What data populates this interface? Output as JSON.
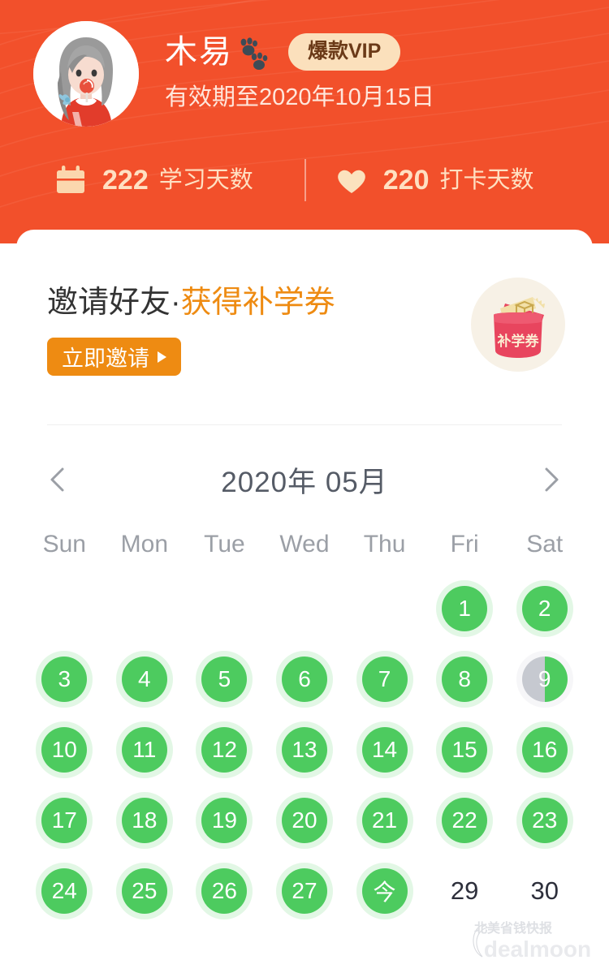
{
  "header": {
    "user_name": "木易",
    "paw_icon": "paw-prints-icon",
    "vip_badge": "爆款VIP",
    "valid_until": "有效期至2020年10月15日",
    "avatar_alt": "girl-with-lollipop-avatar",
    "bg_color": "#F2502B",
    "stats": [
      {
        "icon": "calendar-icon",
        "value": "222",
        "label": "学习天数"
      },
      {
        "icon": "heart-icon",
        "value": "220",
        "label": "打卡天数"
      }
    ]
  },
  "invite": {
    "title_part1": "邀请好友·",
    "title_part2": "获得补学券",
    "button_label": "立即邀请",
    "button_color": "#EE8B12",
    "coupon_icon_label": "补学券",
    "coupon_icon": "coupon-pouch-icon"
  },
  "calendar": {
    "prev_icon": "chevron-left-icon",
    "next_icon": "chevron-right-icon",
    "title": "2020年 05月",
    "year": "2020",
    "month": "05",
    "weekdays": [
      "Sun",
      "Mon",
      "Tue",
      "Wed",
      "Thu",
      "Fri",
      "Sat"
    ],
    "done_color": "#4DCB5F",
    "half_color": "#C6C9D0",
    "plain_color": "#2D2F3B",
    "cells": [
      {
        "label": "",
        "state": "empty"
      },
      {
        "label": "",
        "state": "empty"
      },
      {
        "label": "",
        "state": "empty"
      },
      {
        "label": "",
        "state": "empty"
      },
      {
        "label": "",
        "state": "empty"
      },
      {
        "label": "1",
        "state": "done"
      },
      {
        "label": "2",
        "state": "done"
      },
      {
        "label": "3",
        "state": "done"
      },
      {
        "label": "4",
        "state": "done"
      },
      {
        "label": "5",
        "state": "done"
      },
      {
        "label": "6",
        "state": "done"
      },
      {
        "label": "7",
        "state": "done"
      },
      {
        "label": "8",
        "state": "done"
      },
      {
        "label": "9",
        "state": "half"
      },
      {
        "label": "10",
        "state": "done"
      },
      {
        "label": "11",
        "state": "done"
      },
      {
        "label": "12",
        "state": "done"
      },
      {
        "label": "13",
        "state": "done"
      },
      {
        "label": "14",
        "state": "done"
      },
      {
        "label": "15",
        "state": "done"
      },
      {
        "label": "16",
        "state": "done"
      },
      {
        "label": "17",
        "state": "done"
      },
      {
        "label": "18",
        "state": "done"
      },
      {
        "label": "19",
        "state": "done"
      },
      {
        "label": "20",
        "state": "done"
      },
      {
        "label": "21",
        "state": "done"
      },
      {
        "label": "22",
        "state": "done"
      },
      {
        "label": "23",
        "state": "done"
      },
      {
        "label": "24",
        "state": "done"
      },
      {
        "label": "25",
        "state": "done"
      },
      {
        "label": "26",
        "state": "done"
      },
      {
        "label": "27",
        "state": "done"
      },
      {
        "label": "今",
        "state": "today"
      },
      {
        "label": "29",
        "state": "plain"
      },
      {
        "label": "30",
        "state": "plain"
      }
    ]
  },
  "watermark": {
    "brand": "dealmoon",
    "tagline": "北美省钱快报"
  }
}
